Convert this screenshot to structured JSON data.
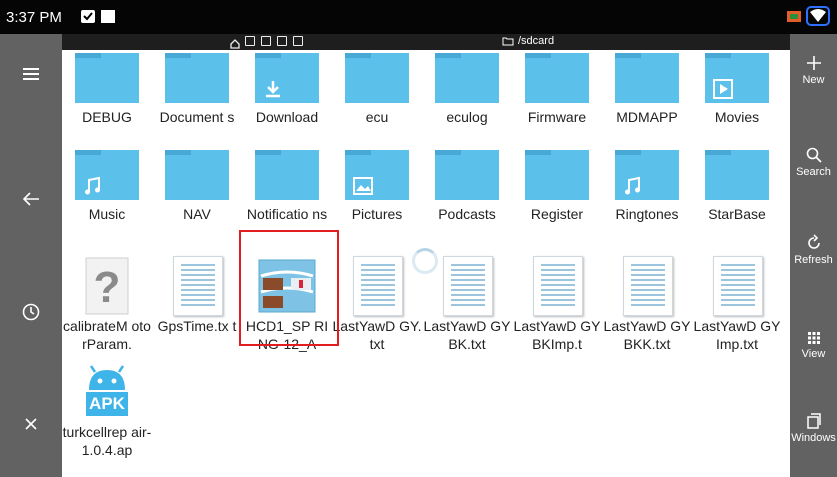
{
  "status": {
    "time": "3:37 PM"
  },
  "path": {
    "label": "/sdcard"
  },
  "colors": {
    "folder": "#5bc0ea",
    "rail": "#626262",
    "highlight": "#e01e1e"
  },
  "right_actions": [
    {
      "label": "New",
      "icon": "plus-icon"
    },
    {
      "label": "Search",
      "icon": "search-icon"
    },
    {
      "label": "Refresh",
      "icon": "refresh-icon"
    },
    {
      "label": "View",
      "icon": "grid-icon"
    },
    {
      "label": "Windows",
      "icon": "windows-icon"
    }
  ],
  "left_actions": [
    {
      "icon": "menu-icon"
    },
    {
      "icon": "back-arrow-icon"
    },
    {
      "icon": "clock-icon"
    },
    {
      "icon": "close-icon"
    }
  ],
  "files": [
    {
      "name": "DEBUG",
      "type": "folder"
    },
    {
      "name": "Document s",
      "type": "folder"
    },
    {
      "name": "Download",
      "type": "folder",
      "overlay": "download-icon"
    },
    {
      "name": "ecu",
      "type": "folder"
    },
    {
      "name": "eculog",
      "type": "folder"
    },
    {
      "name": "Firmware",
      "type": "folder"
    },
    {
      "name": "MDMAPP",
      "type": "folder"
    },
    {
      "name": "Movies",
      "type": "folder",
      "overlay": "play-icon"
    },
    {
      "name": "Music",
      "type": "folder",
      "overlay": "music-note-icon"
    },
    {
      "name": "NAV",
      "type": "folder"
    },
    {
      "name": "Notificatio ns",
      "type": "folder"
    },
    {
      "name": "Pictures",
      "type": "folder",
      "overlay": "image-icon"
    },
    {
      "name": "Podcasts",
      "type": "folder"
    },
    {
      "name": "Register",
      "type": "folder"
    },
    {
      "name": "Ringtones",
      "type": "folder",
      "overlay": "music-note-icon"
    },
    {
      "name": "StarBase",
      "type": "folder"
    },
    {
      "name": "calibrateM otorParam.",
      "type": "unknown"
    },
    {
      "name": "GpsTime.tx t",
      "type": "text"
    },
    {
      "name": "HCD1_SP RING-12_A",
      "type": "archive",
      "selected": true
    },
    {
      "name": "LastYawD GY.txt",
      "type": "text"
    },
    {
      "name": "LastYawD GYBK.txt",
      "type": "text"
    },
    {
      "name": "LastYawD GYBKImp.t",
      "type": "text"
    },
    {
      "name": "LastYawD GYBKK.txt",
      "type": "text"
    },
    {
      "name": "LastYawD GYImp.txt",
      "type": "text"
    },
    {
      "name": "turkcellrep air-1.0.4.ap",
      "type": "apk",
      "badge": "APK"
    }
  ]
}
